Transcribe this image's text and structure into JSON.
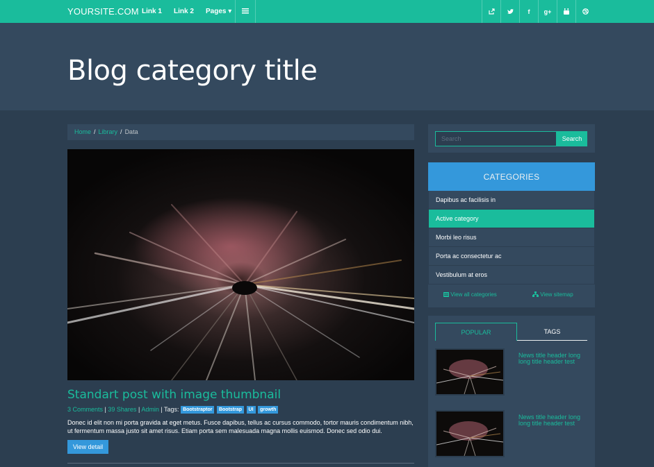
{
  "nav": {
    "brand": "YOURSITE.COM",
    "links": [
      "Link 1",
      "Link 2",
      "Pages ▾"
    ],
    "social": [
      "share-icon",
      "twitter-icon",
      "facebook-icon",
      "googleplus-icon",
      "youtube-icon",
      "dribbble-icon"
    ]
  },
  "hero": {
    "title": "Blog category title"
  },
  "breadcrumb": {
    "home": "Home",
    "library": "Library",
    "current": "Data",
    "separator": "/"
  },
  "post": {
    "title": "Standart post with image thumbnail",
    "comments": "3 Comments",
    "shares": "39 Shares",
    "author": "Admin",
    "meta_sep": "|",
    "tags_label": "Tags:",
    "tags": [
      "Bootstraptor",
      "Bootstrap",
      "UI",
      "growth"
    ],
    "excerpt": "Donec id elit non mi porta gravida at eget metus. Fusce dapibus, tellus ac cursus commodo, tortor mauris condimentum nibh, ut fermentum massa justo sit amet risus. Etiam porta sem malesuada magna mollis euismod. Donec sed odio dui.",
    "button": "View detail"
  },
  "search": {
    "placeholder": "Search",
    "button": "Search"
  },
  "categories": {
    "header": "CATEGORIES",
    "items": [
      "Dapibus ac facilisis in",
      "Active category",
      "Morbi leo risus",
      "Porta ac consectetur ac",
      "Vestibulum at eros"
    ],
    "active_index": 1,
    "view_all": "View all categories",
    "view_sitemap": "View sitemap"
  },
  "widget_tabs": {
    "popular": "POPULAR",
    "tags": "TAGS",
    "news": [
      "News title header long long title header test",
      "News title header long long title header test"
    ]
  },
  "colors": {
    "accent": "#1abc9c",
    "blue": "#3498db",
    "bg": "#2c3e50",
    "panel": "#34495e"
  }
}
